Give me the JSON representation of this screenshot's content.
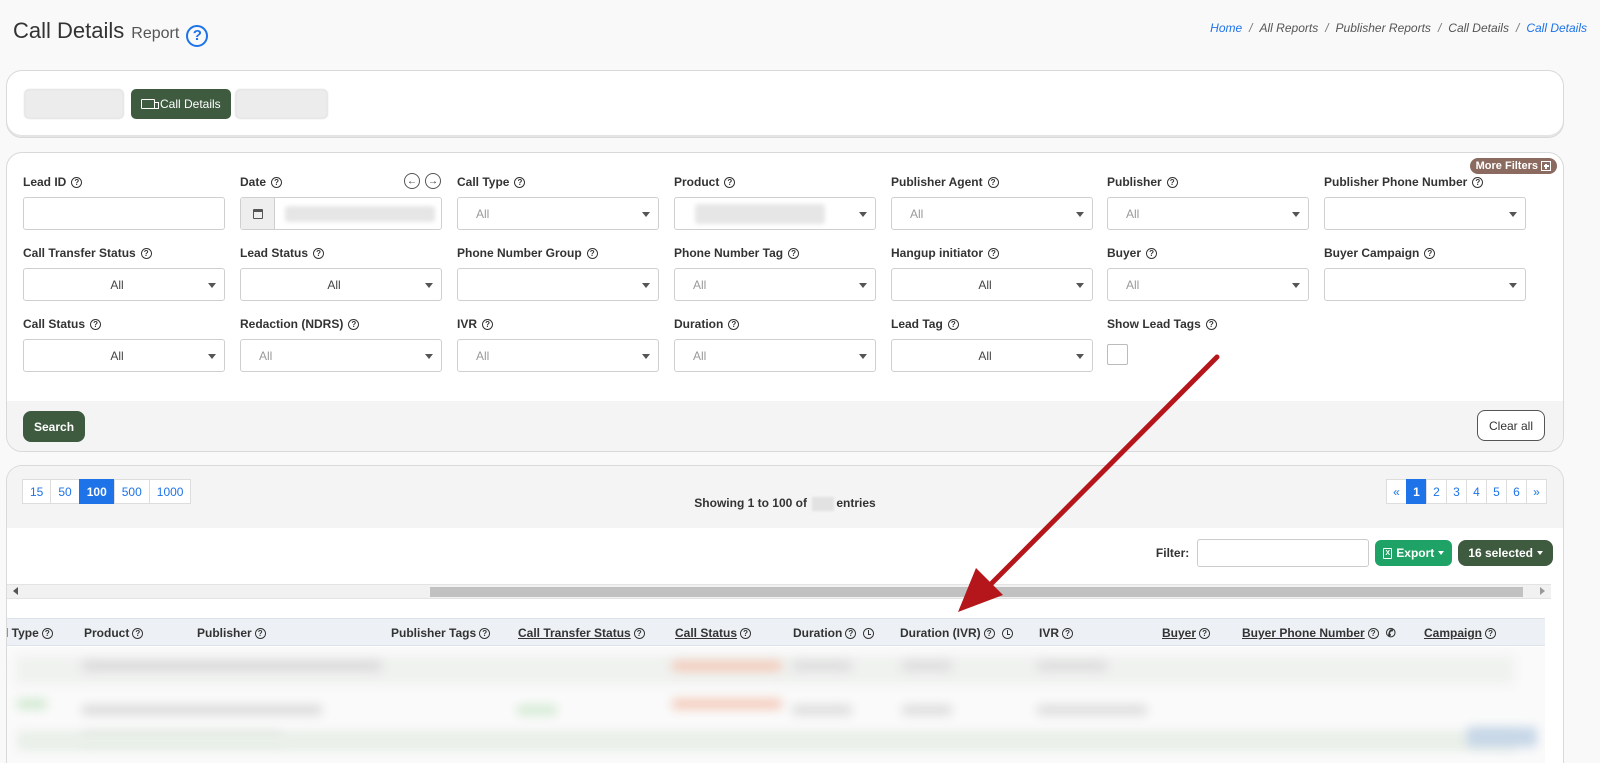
{
  "header": {
    "title": "Call Details",
    "subtitle": "Report",
    "help_glyph": "?"
  },
  "breadcrumb": [
    "Home",
    "All Reports",
    "Publisher Reports",
    "Call Details",
    "Call Details"
  ],
  "breadcrumb_sep": "/",
  "tabs": {
    "active_label": "Call Details"
  },
  "filters": {
    "more_filters": "More Filters",
    "help_glyph": "?",
    "nav_prev": "←",
    "nav_next": "→",
    "labels": {
      "lead_id": "Lead ID",
      "date": "Date",
      "call_type": "Call Type",
      "product": "Product",
      "publisher_agent": "Publisher Agent",
      "publisher": "Publisher",
      "publisher_phone_number": "Publisher Phone Number",
      "call_transfer_status": "Call Transfer Status",
      "lead_status": "Lead Status",
      "phone_number_group": "Phone Number Group",
      "phone_number_tag": "Phone Number Tag",
      "hangup_initiator": "Hangup initiator",
      "buyer": "Buyer",
      "buyer_campaign": "Buyer Campaign",
      "call_status": "Call Status",
      "redaction": "Redaction (NDRS)",
      "ivr": "IVR",
      "duration": "Duration",
      "lead_tag": "Lead Tag",
      "show_lead_tags": "Show Lead Tags"
    },
    "values": {
      "call_type": "All",
      "publisher_agent": "All",
      "publisher": "All",
      "call_transfer_status": "All",
      "lead_status": "All",
      "phone_number_tag": "All",
      "hangup_initiator": "All",
      "buyer": "All",
      "call_status": "All",
      "redaction": "All",
      "ivr": "All",
      "duration": "All",
      "lead_tag": "All"
    },
    "search_label": "Search",
    "clear_label": "Clear all"
  },
  "table": {
    "page_lengths": [
      "15",
      "50",
      "100",
      "500",
      "1000"
    ],
    "active_length": "100",
    "showing_prefix": "Showing 1 to 100 of",
    "showing_suffix": "entries",
    "pager": [
      "«",
      "1",
      "2",
      "3",
      "4",
      "5",
      "6",
      "»"
    ],
    "active_page": "1",
    "filter_label": "Filter:",
    "export_label": "Export",
    "export_icon_glyph": "X",
    "selected_label": "16 selected",
    "columns": {
      "call_type": "l Type",
      "product": "Product",
      "publisher": "Publisher",
      "publisher_tags": "Publisher Tags",
      "call_transfer_status": "Call Transfer Status",
      "call_status": "Call Status",
      "duration": "Duration",
      "duration_ivr": "Duration (IVR)",
      "ivr": "IVR",
      "buyer": "Buyer",
      "buyer_phone_number": "Buyer Phone Number",
      "campaign": "Campaign"
    },
    "phone_glyph": "✆"
  },
  "colors": {
    "primary_green": "#3e5a3f",
    "link_blue": "#1e73e8",
    "export_green": "#1fa265",
    "annotation_red": "#b5161b"
  }
}
